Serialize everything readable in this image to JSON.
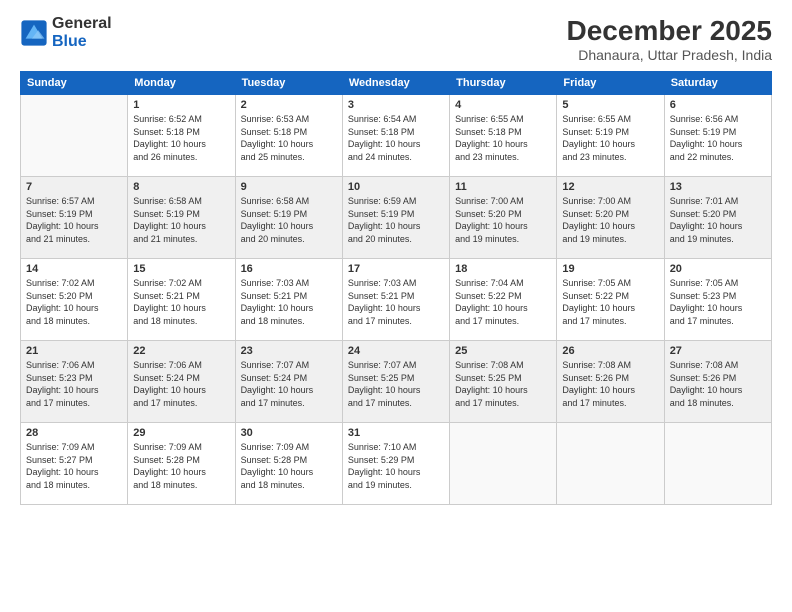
{
  "logo": {
    "general": "General",
    "blue": "Blue"
  },
  "header": {
    "month": "December 2025",
    "location": "Dhanaura, Uttar Pradesh, India"
  },
  "days_of_week": [
    "Sunday",
    "Monday",
    "Tuesday",
    "Wednesday",
    "Thursday",
    "Friday",
    "Saturday"
  ],
  "weeks": [
    [
      {
        "day": "",
        "info": ""
      },
      {
        "day": "1",
        "info": "Sunrise: 6:52 AM\nSunset: 5:18 PM\nDaylight: 10 hours\nand 26 minutes."
      },
      {
        "day": "2",
        "info": "Sunrise: 6:53 AM\nSunset: 5:18 PM\nDaylight: 10 hours\nand 25 minutes."
      },
      {
        "day": "3",
        "info": "Sunrise: 6:54 AM\nSunset: 5:18 PM\nDaylight: 10 hours\nand 24 minutes."
      },
      {
        "day": "4",
        "info": "Sunrise: 6:55 AM\nSunset: 5:18 PM\nDaylight: 10 hours\nand 23 minutes."
      },
      {
        "day": "5",
        "info": "Sunrise: 6:55 AM\nSunset: 5:19 PM\nDaylight: 10 hours\nand 23 minutes."
      },
      {
        "day": "6",
        "info": "Sunrise: 6:56 AM\nSunset: 5:19 PM\nDaylight: 10 hours\nand 22 minutes."
      }
    ],
    [
      {
        "day": "7",
        "info": "Sunrise: 6:57 AM\nSunset: 5:19 PM\nDaylight: 10 hours\nand 21 minutes."
      },
      {
        "day": "8",
        "info": "Sunrise: 6:58 AM\nSunset: 5:19 PM\nDaylight: 10 hours\nand 21 minutes."
      },
      {
        "day": "9",
        "info": "Sunrise: 6:58 AM\nSunset: 5:19 PM\nDaylight: 10 hours\nand 20 minutes."
      },
      {
        "day": "10",
        "info": "Sunrise: 6:59 AM\nSunset: 5:19 PM\nDaylight: 10 hours\nand 20 minutes."
      },
      {
        "day": "11",
        "info": "Sunrise: 7:00 AM\nSunset: 5:20 PM\nDaylight: 10 hours\nand 19 minutes."
      },
      {
        "day": "12",
        "info": "Sunrise: 7:00 AM\nSunset: 5:20 PM\nDaylight: 10 hours\nand 19 minutes."
      },
      {
        "day": "13",
        "info": "Sunrise: 7:01 AM\nSunset: 5:20 PM\nDaylight: 10 hours\nand 19 minutes."
      }
    ],
    [
      {
        "day": "14",
        "info": "Sunrise: 7:02 AM\nSunset: 5:20 PM\nDaylight: 10 hours\nand 18 minutes."
      },
      {
        "day": "15",
        "info": "Sunrise: 7:02 AM\nSunset: 5:21 PM\nDaylight: 10 hours\nand 18 minutes."
      },
      {
        "day": "16",
        "info": "Sunrise: 7:03 AM\nSunset: 5:21 PM\nDaylight: 10 hours\nand 18 minutes."
      },
      {
        "day": "17",
        "info": "Sunrise: 7:03 AM\nSunset: 5:21 PM\nDaylight: 10 hours\nand 17 minutes."
      },
      {
        "day": "18",
        "info": "Sunrise: 7:04 AM\nSunset: 5:22 PM\nDaylight: 10 hours\nand 17 minutes."
      },
      {
        "day": "19",
        "info": "Sunrise: 7:05 AM\nSunset: 5:22 PM\nDaylight: 10 hours\nand 17 minutes."
      },
      {
        "day": "20",
        "info": "Sunrise: 7:05 AM\nSunset: 5:23 PM\nDaylight: 10 hours\nand 17 minutes."
      }
    ],
    [
      {
        "day": "21",
        "info": "Sunrise: 7:06 AM\nSunset: 5:23 PM\nDaylight: 10 hours\nand 17 minutes."
      },
      {
        "day": "22",
        "info": "Sunrise: 7:06 AM\nSunset: 5:24 PM\nDaylight: 10 hours\nand 17 minutes."
      },
      {
        "day": "23",
        "info": "Sunrise: 7:07 AM\nSunset: 5:24 PM\nDaylight: 10 hours\nand 17 minutes."
      },
      {
        "day": "24",
        "info": "Sunrise: 7:07 AM\nSunset: 5:25 PM\nDaylight: 10 hours\nand 17 minutes."
      },
      {
        "day": "25",
        "info": "Sunrise: 7:08 AM\nSunset: 5:25 PM\nDaylight: 10 hours\nand 17 minutes."
      },
      {
        "day": "26",
        "info": "Sunrise: 7:08 AM\nSunset: 5:26 PM\nDaylight: 10 hours\nand 17 minutes."
      },
      {
        "day": "27",
        "info": "Sunrise: 7:08 AM\nSunset: 5:26 PM\nDaylight: 10 hours\nand 18 minutes."
      }
    ],
    [
      {
        "day": "28",
        "info": "Sunrise: 7:09 AM\nSunset: 5:27 PM\nDaylight: 10 hours\nand 18 minutes."
      },
      {
        "day": "29",
        "info": "Sunrise: 7:09 AM\nSunset: 5:28 PM\nDaylight: 10 hours\nand 18 minutes."
      },
      {
        "day": "30",
        "info": "Sunrise: 7:09 AM\nSunset: 5:28 PM\nDaylight: 10 hours\nand 18 minutes."
      },
      {
        "day": "31",
        "info": "Sunrise: 7:10 AM\nSunset: 5:29 PM\nDaylight: 10 hours\nand 19 minutes."
      },
      {
        "day": "",
        "info": ""
      },
      {
        "day": "",
        "info": ""
      },
      {
        "day": "",
        "info": ""
      }
    ]
  ]
}
